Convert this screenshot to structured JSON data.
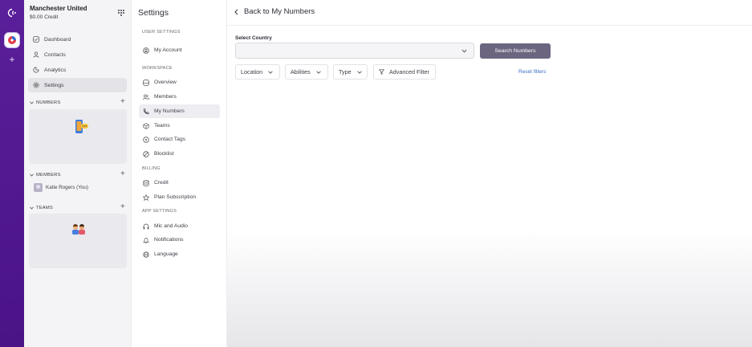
{
  "organization": {
    "name": "Manchester United",
    "credit": "$0.00 Credit"
  },
  "nav": [
    {
      "label": "Dashboard",
      "icon": "dashboard-icon"
    },
    {
      "label": "Contacts",
      "icon": "user-icon"
    },
    {
      "label": "Analytics",
      "icon": "analytics-icon"
    },
    {
      "label": "Settings",
      "icon": "gear-icon",
      "active": true
    }
  ],
  "sections": {
    "numbers": "NUMBERS",
    "members": "MEMBERS",
    "teams": "TEAMS",
    "member_name": "Katie Rogers (You)"
  },
  "settings": {
    "title": "Settings",
    "groups": {
      "user": "USER SETTINGS",
      "workspace": "WORKSPACE",
      "billing": "BILLING",
      "app": "APP SETTINGS"
    },
    "items": {
      "my_account": "My Account",
      "overview": "Overview",
      "members": "Members",
      "my_numbers": "My Numbers",
      "teams": "Teams",
      "contact_tags": "Contact Tags",
      "blocklist": "Blocklist",
      "credit": "Credit",
      "plan_subscription": "Plan Subscription",
      "mic_audio": "Mic and Audio",
      "notifications": "Notifications",
      "language": "Language"
    }
  },
  "main": {
    "back_label": "Back to My Numbers",
    "country_label": "Select Country",
    "country_value": "",
    "search_button": "Search Numbers",
    "filters": {
      "location": "Location",
      "abilities": "Abilities",
      "type": "Type",
      "advanced": "Advanced Filter"
    },
    "reset_label": "Reset filters"
  },
  "colors": {
    "rail": "#4a1386",
    "accent_button": "#6b6580",
    "link": "#3b6bc9"
  }
}
